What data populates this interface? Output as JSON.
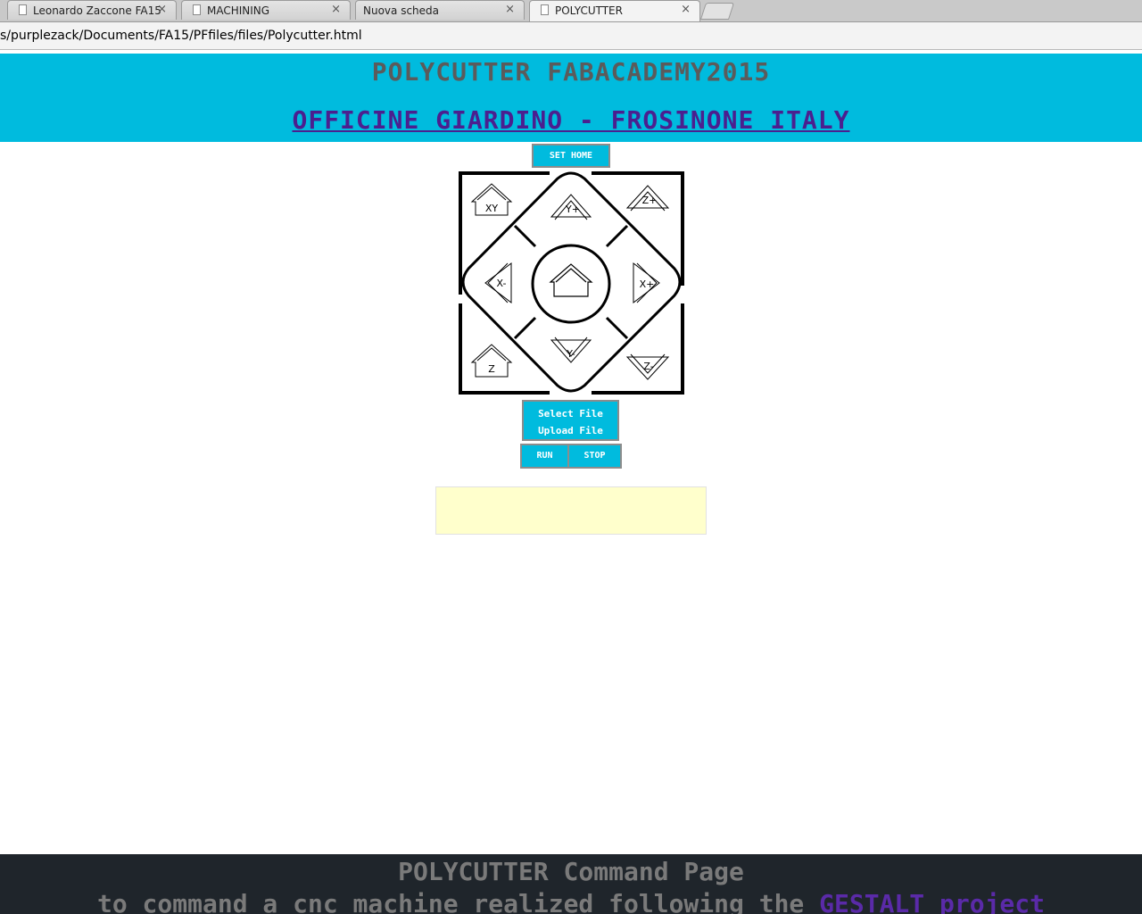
{
  "browser": {
    "tabs": [
      {
        "label": "Leonardo Zaccone FA15",
        "close": "×"
      },
      {
        "label": "MACHINING",
        "close": "×"
      },
      {
        "label": "Nuova scheda",
        "close": "×"
      },
      {
        "label": "POLYCUTTER",
        "close": "×"
      }
    ],
    "url": "s/purplezack/Documents/FA15/PFfiles/files/Polycutter.html"
  },
  "header": {
    "title": "POLYCUTTER FABACADEMY2015",
    "subtitle": "OFFICINE GIARDINO - FROSINONE ITALY"
  },
  "controls": {
    "set_home": "SET HOME",
    "jog": {
      "home_xy": "XY",
      "y_plus": "Y+",
      "z_plus": "Z+",
      "x_minus": "X-",
      "x_plus": "X+",
      "home_z": "Z",
      "y_minus": "Y-",
      "z_minus": "Z-"
    },
    "select_file": "Select File",
    "upload_file": "Upload File",
    "run": "RUN",
    "stop": "STOP"
  },
  "footer": {
    "title": "POLYCUTTER Command Page",
    "line_prefix": "to command a cnc machine realized following the ",
    "link": "GESTALT project"
  },
  "colors": {
    "accent": "#00bbde",
    "subtitle": "#4b1f8f",
    "console_bg": "#ffffcc",
    "footer_bg": "#1f252b"
  }
}
